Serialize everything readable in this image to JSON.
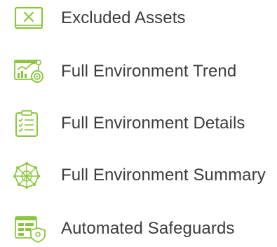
{
  "menu": {
    "accent_color": "#8cc63f",
    "text_color": "#3c3c3c",
    "items": [
      {
        "label": "Excluded Assets",
        "icon": "excluded-assets-icon"
      },
      {
        "label": "Full Environment Trend",
        "icon": "environment-trend-icon"
      },
      {
        "label": "Full Environment Details",
        "icon": "clipboard-checklist-icon"
      },
      {
        "label": "Full Environment Summary",
        "icon": "network-globe-icon"
      },
      {
        "label": "Automated Safeguards",
        "icon": "safeguards-shield-icon"
      }
    ]
  }
}
